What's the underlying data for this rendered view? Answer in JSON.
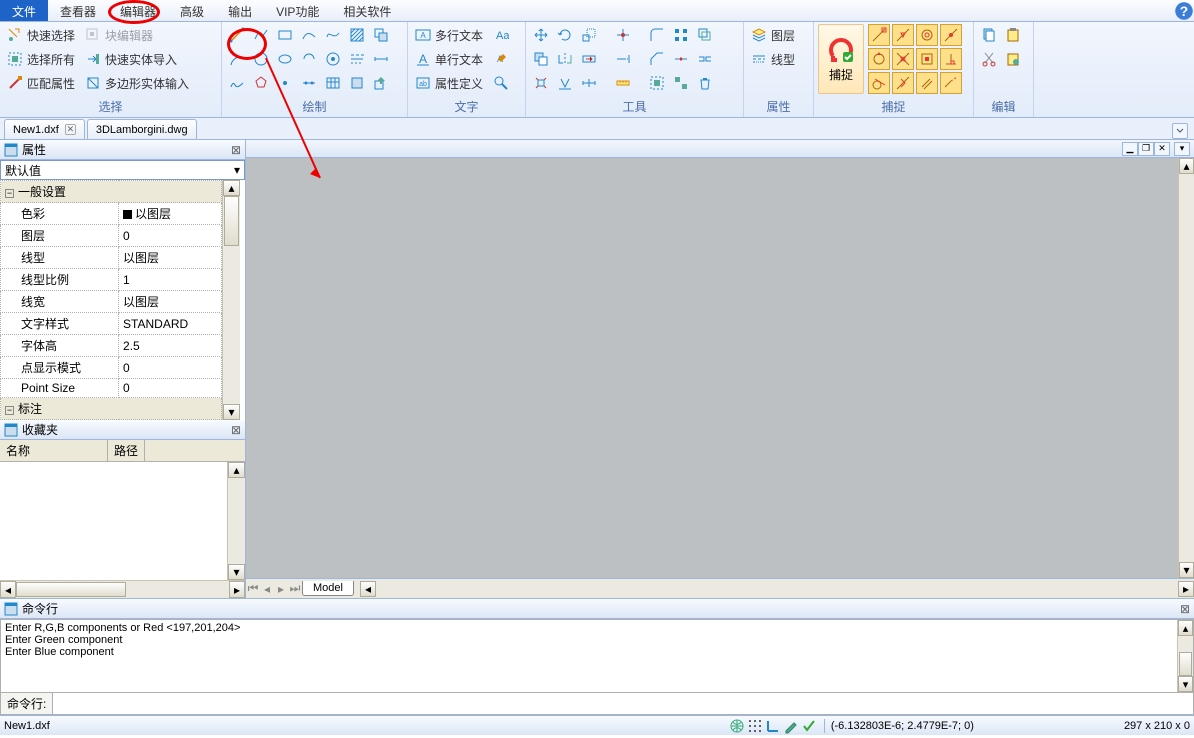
{
  "menubar": {
    "items": [
      "文件",
      "查看器",
      "编辑器",
      "高级",
      "输出",
      "VIP功能",
      "相关软件"
    ],
    "active": 0
  },
  "ribbon": {
    "groups": {
      "select": {
        "label": "选择",
        "btn1": "快速选择",
        "btn2": "选择所有",
        "btn3": "匹配属性",
        "btn4": "块编辑器",
        "btn5": "快速实体导入",
        "btn6": "多边形实体输入"
      },
      "draw": {
        "label": "绘制"
      },
      "text": {
        "label": "文字",
        "btn1": "多行文本",
        "btn2": "单行文本",
        "btn3": "属性定义"
      },
      "tools": {
        "label": "工具"
      },
      "attr": {
        "label": "属性",
        "btn1": "图层",
        "btn2": "线型"
      },
      "snap": {
        "label": "捕捉",
        "big": "捕捉"
      },
      "edit": {
        "label": "编辑"
      }
    }
  },
  "tabs": {
    "t1": "New1.dxf",
    "t2": "3DLamborgini.dwg"
  },
  "panels": {
    "props": {
      "title": "属性",
      "default": "默认值",
      "section1": "一般设置",
      "rows": [
        {
          "k": "色彩",
          "v": "以图层",
          "sq": true
        },
        {
          "k": "图层",
          "v": "0"
        },
        {
          "k": "线型",
          "v": "以图层"
        },
        {
          "k": "线型比例",
          "v": "1"
        },
        {
          "k": "线宽",
          "v": "以图层"
        },
        {
          "k": "文字样式",
          "v": "STANDARD"
        },
        {
          "k": "字体高",
          "v": "2.5"
        },
        {
          "k": "点显示模式",
          "v": "0"
        },
        {
          "k": "Point Size",
          "v": "0"
        }
      ],
      "section2": "标注"
    },
    "favs": {
      "title": "收藏夹",
      "col1": "名称",
      "col2": "路径"
    },
    "cmd": {
      "title": "命令行"
    }
  },
  "canvas": {
    "modeltab": "Model"
  },
  "log": {
    "l1": "Enter R,G,B components or Red <197,201,204>",
    "l2": "Enter Green component",
    "l3": "Enter Blue component"
  },
  "cmdLabel": "命令行:",
  "status": {
    "file": "New1.dxf",
    "coords": "(-6.132803E-6; 2.4779E-7; 0)",
    "dims": "297 x 210 x 0"
  }
}
